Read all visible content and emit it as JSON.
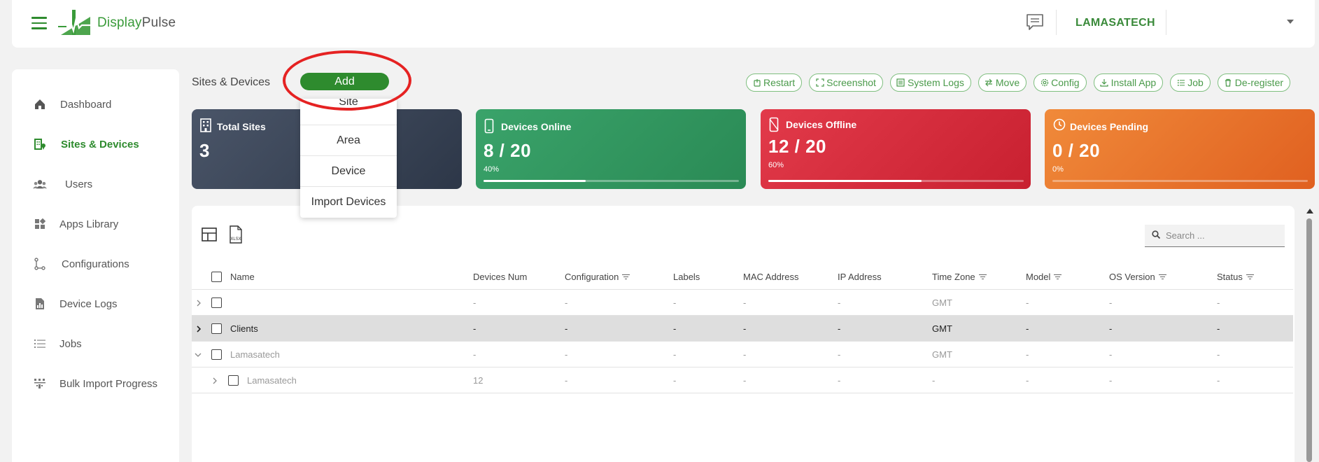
{
  "app": {
    "name_part1": "Display",
    "name_part2": "Pulse",
    "org": "LAMASATECH"
  },
  "sidebar": {
    "items": [
      {
        "label": "Dashboard",
        "icon": "home-icon"
      },
      {
        "label": "Sites & Devices",
        "icon": "building-pin-icon",
        "active": true
      },
      {
        "label": "Users",
        "icon": "users-icon"
      },
      {
        "label": "Apps Library",
        "icon": "apps-icon"
      },
      {
        "label": "Configurations",
        "icon": "config-icon"
      },
      {
        "label": "Device Logs",
        "icon": "device-logs-icon"
      },
      {
        "label": "Jobs",
        "icon": "jobs-icon"
      },
      {
        "label": "Bulk Import Progress",
        "icon": "bulk-import-icon"
      }
    ]
  },
  "page": {
    "title": "Sites & Devices",
    "add_label": "Add"
  },
  "add_menu": [
    "Site",
    "Area",
    "Device",
    "Import Devices"
  ],
  "actions": [
    "Restart",
    "Screenshot",
    "System Logs",
    "Move",
    "Config",
    "Install App",
    "Job",
    "De-register"
  ],
  "stats": {
    "total_sites": {
      "title": "Total Sites",
      "value": "3"
    },
    "online": {
      "title": "Devices Online",
      "value": "8 / 20",
      "pct": "40%",
      "fraction": 0.4
    },
    "offline": {
      "title": "Devices Offline",
      "value": "12 / 20",
      "pct": "60%",
      "fraction": 0.6
    },
    "pending": {
      "title": "Devices Pending",
      "value": "0 / 20",
      "pct": "0%",
      "fraction": 0.0
    }
  },
  "table": {
    "search_placeholder": "Search ...",
    "export_label": "XLSX",
    "columns": [
      "Name",
      "Devices Num",
      "Configuration",
      "Labels",
      "MAC Address",
      "IP Address",
      "Time Zone",
      "Model",
      "OS Version",
      "Status"
    ],
    "rows": [
      {
        "name": "",
        "devices": "-",
        "config": "-",
        "labels": "-",
        "mac": "-",
        "ip": "-",
        "tz": "GMT",
        "model": "-",
        "os": "-",
        "status": "-"
      },
      {
        "name": "Clients",
        "devices": "-",
        "config": "-",
        "labels": "-",
        "mac": "-",
        "ip": "-",
        "tz": "GMT",
        "model": "-",
        "os": "-",
        "status": "-"
      },
      {
        "name": "Lamasatech",
        "devices": "-",
        "config": "-",
        "labels": "-",
        "mac": "-",
        "ip": "-",
        "tz": "GMT",
        "model": "-",
        "os": "-",
        "status": "-"
      },
      {
        "name": "Lamasatech",
        "devices": "12",
        "config": "-",
        "labels": "-",
        "mac": "-",
        "ip": "-",
        "tz": "-",
        "model": "-",
        "os": "-",
        "status": "-"
      }
    ]
  }
}
